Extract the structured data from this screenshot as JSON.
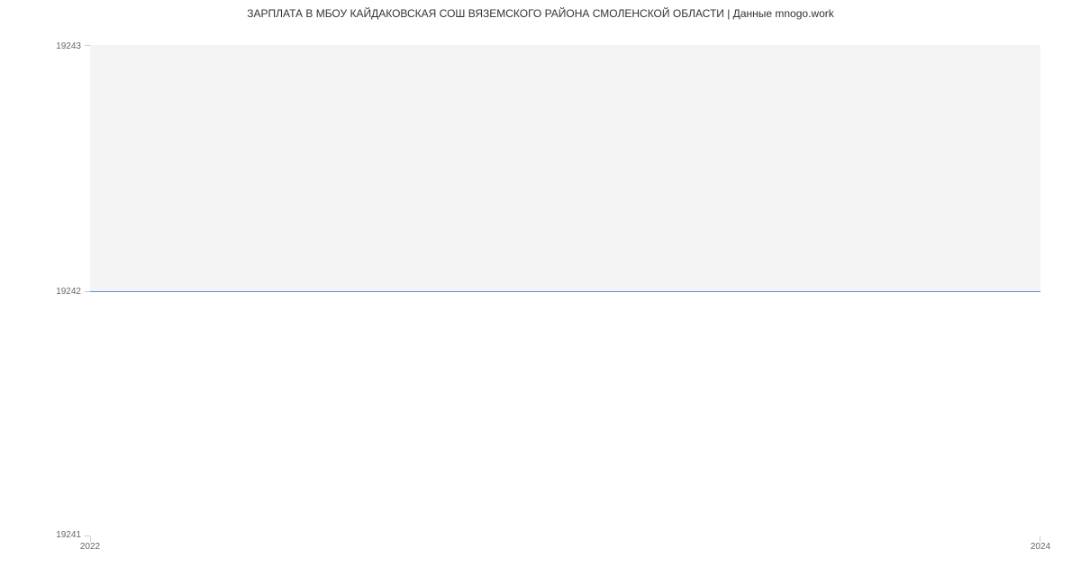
{
  "chart_data": {
    "type": "line",
    "title": "ЗАРПЛАТА В МБОУ КАЙДАКОВСКАЯ СОШ ВЯЗЕМСКОГО РАЙОНА СМОЛЕНСКОЙ ОБЛАСТИ | Данные mnogo.work",
    "x": [
      2022,
      2024
    ],
    "values": [
      19242,
      19242
    ],
    "xlabel": "",
    "ylabel": "",
    "ylim": [
      19241,
      19243
    ],
    "y_ticks": [
      19241,
      19242,
      19243
    ],
    "x_ticks": [
      2022,
      2024
    ],
    "grid": false,
    "line_color": "#5b8fd6",
    "band_upper_color": "#f4f4f4",
    "band_lower_color": "#ffffff"
  }
}
